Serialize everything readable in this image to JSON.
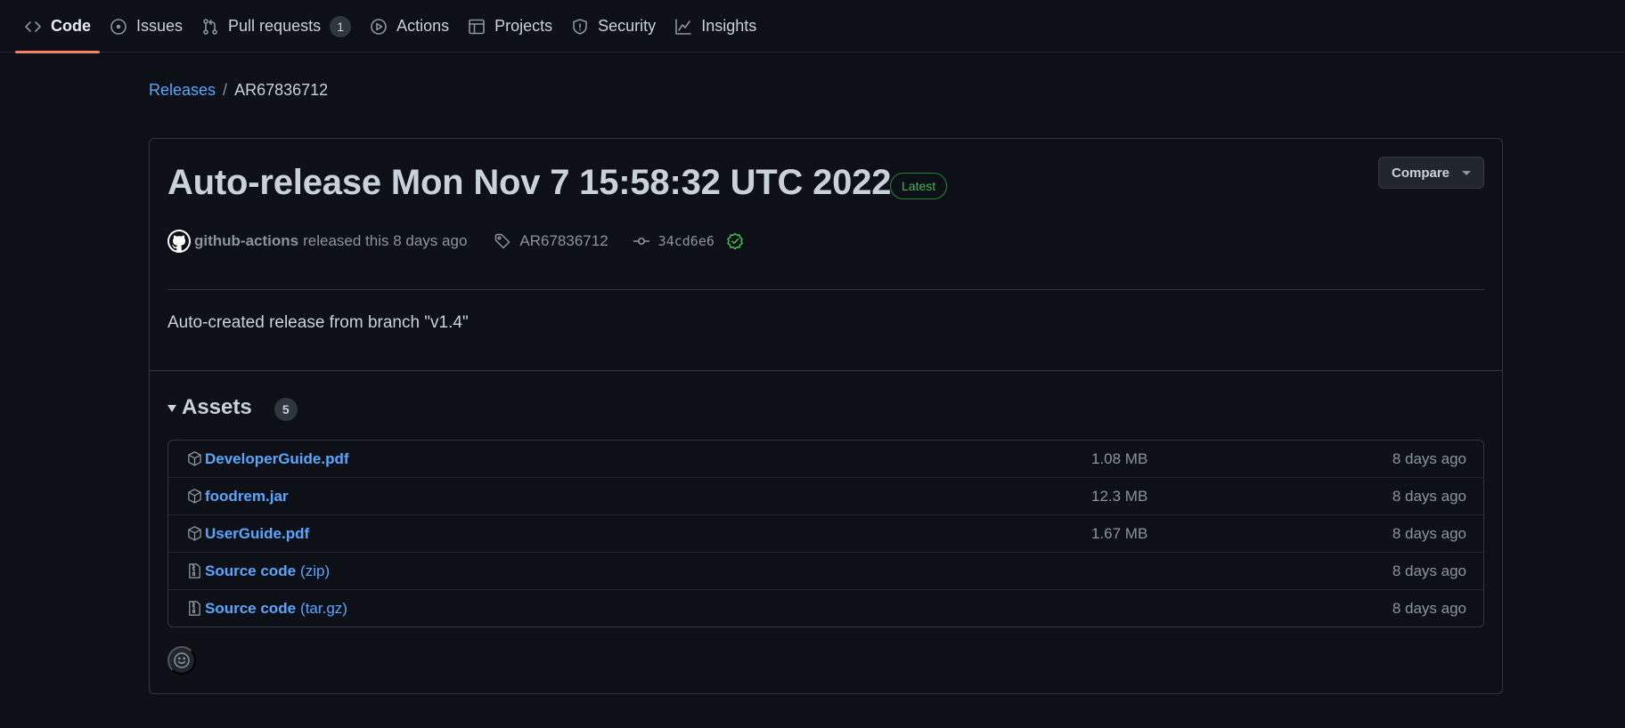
{
  "repo_nav": {
    "tabs": [
      {
        "label": "Code",
        "icon": "code-icon",
        "selected": true
      },
      {
        "label": "Issues",
        "icon": "issue-opened-icon"
      },
      {
        "label": "Pull requests",
        "icon": "git-pull-request-icon",
        "counter": "1"
      },
      {
        "label": "Actions",
        "icon": "play-icon"
      },
      {
        "label": "Projects",
        "icon": "table-icon"
      },
      {
        "label": "Security",
        "icon": "shield-icon"
      },
      {
        "label": "Insights",
        "icon": "graph-icon"
      }
    ]
  },
  "breadcrumb": {
    "root": "Releases",
    "separator": "/",
    "current": "AR67836712"
  },
  "release": {
    "title": "Auto-release Mon Nov 7 15:58:32 UTC 2022",
    "badge": "Latest",
    "compare_label": "Compare",
    "author": "github-actions",
    "released_text": "released this 8 days ago",
    "tag": "AR67836712",
    "commit": "34cd6e6",
    "commit_verified": true,
    "body": "Auto-created release from branch \"v1.4\""
  },
  "assets": {
    "title": "Assets",
    "count": "5",
    "items": [
      {
        "name": "DeveloperGuide.pdf",
        "sub": "",
        "size": "1.08 MB",
        "date": "8 days ago",
        "icon": "package-icon"
      },
      {
        "name": "foodrem.jar",
        "sub": "",
        "size": "12.3 MB",
        "date": "8 days ago",
        "icon": "package-icon"
      },
      {
        "name": "UserGuide.pdf",
        "sub": "",
        "size": "1.67 MB",
        "date": "8 days ago",
        "icon": "package-icon"
      },
      {
        "name": "Source code",
        "sub": "(zip)",
        "size": "",
        "date": "8 days ago",
        "icon": "file-zip-icon"
      },
      {
        "name": "Source code",
        "sub": "(tar.gz)",
        "size": "",
        "date": "8 days ago",
        "icon": "file-zip-icon"
      }
    ]
  },
  "colors": {
    "background": "#0d1117",
    "link": "#58a6ff",
    "selected_tab_underline": "#f78166",
    "latest_badge": "#3fb950",
    "border": "#30363d"
  }
}
